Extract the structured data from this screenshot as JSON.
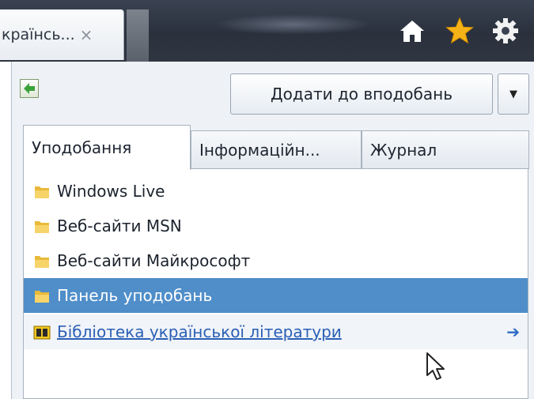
{
  "browser": {
    "tab_title": "країнсь...",
    "tab_close": "×",
    "icons": [
      "home-icon",
      "star-icon",
      "gear-icon"
    ]
  },
  "favorites_panel": {
    "add_button_label": "Додати до вподобань",
    "add_dropdown_glyph": "▼",
    "tabs": [
      {
        "label": "Уподобання",
        "active": true
      },
      {
        "label": "Інформаційн...",
        "active": false
      },
      {
        "label": "Журнал",
        "active": false
      }
    ],
    "items": [
      {
        "label": "Windows Live",
        "icon": "folder-icon"
      },
      {
        "label": "Веб-сайти MSN",
        "icon": "folder-icon"
      },
      {
        "label": "Веб-сайти Майкрософт",
        "icon": "folder-icon"
      },
      {
        "label": "Панель уподобань",
        "icon": "folder-icon",
        "selected": true
      },
      {
        "label": "Бібліотека української літератури",
        "icon": "book-icon",
        "link": true,
        "arrow": "➔"
      }
    ]
  },
  "colors": {
    "selection": "#4f8ec9",
    "link": "#2b5fb5",
    "star": "#f5b318",
    "titlebar": "#2f3541"
  }
}
